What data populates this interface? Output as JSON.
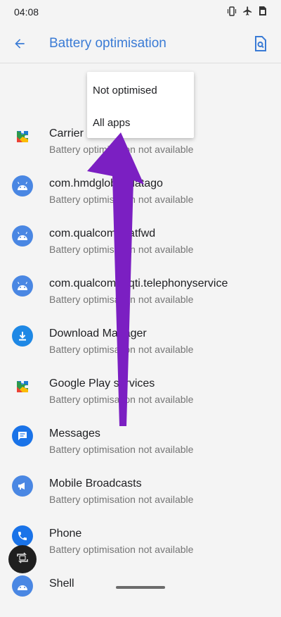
{
  "status_bar": {
    "time": "04:08",
    "icons": [
      "vibrate-icon",
      "airplane-icon",
      "sim-icon"
    ]
  },
  "app_bar": {
    "title": "Battery optimisation",
    "back_icon": "arrow-back-icon",
    "action_icon": "search-document-icon"
  },
  "dropdown": {
    "options": [
      "Not optimised",
      "All apps"
    ]
  },
  "apps": [
    {
      "name": "Carrier Services",
      "status": "Battery optimisation not available",
      "icon": "puzzle-icon"
    },
    {
      "name": "com.hmdglobal.datago",
      "status": "Battery optimisation not available",
      "icon": "android-icon"
    },
    {
      "name": "com.qualcomm.atfwd",
      "status": "Battery optimisation not available",
      "icon": "android-icon"
    },
    {
      "name": "com.qualcomm.qti.telephonyservice",
      "status": "Battery optimisation not available",
      "icon": "android-icon"
    },
    {
      "name": "Download Manager",
      "status": "Battery optimisation not available",
      "icon": "download-icon"
    },
    {
      "name": "Google Play services",
      "status": "Battery optimisation not available",
      "icon": "puzzle-icon"
    },
    {
      "name": "Messages",
      "status": "Battery optimisation not available",
      "icon": "message-icon"
    },
    {
      "name": "Mobile Broadcasts",
      "status": "Battery optimisation not available",
      "icon": "megaphone-icon"
    },
    {
      "name": "Phone",
      "status": "Battery optimisation not available",
      "icon": "phone-icon"
    },
    {
      "name": "Shell",
      "status": "",
      "icon": "android-icon"
    }
  ],
  "colors": {
    "accent": "#3a7bd5",
    "android_blue": "#4a87e3",
    "annotation_arrow": "#7b1fc2"
  }
}
